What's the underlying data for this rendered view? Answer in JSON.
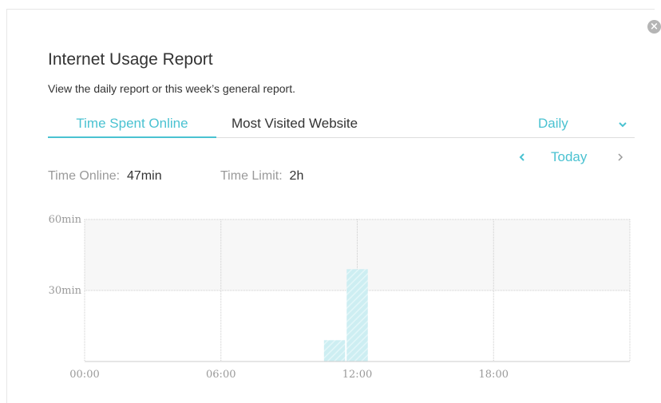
{
  "dialog": {
    "title": "Internet Usage Report",
    "subtitle": "View the daily report or this week’s general report.",
    "close_icon": "close-icon"
  },
  "tabs": [
    {
      "label": "Time Spent Online",
      "active": true
    },
    {
      "label": "Most Visited Website",
      "active": false
    }
  ],
  "period": {
    "selected": "Daily",
    "icon": "chevron-down-icon"
  },
  "date_nav": {
    "prev_icon": "chevron-left-icon",
    "label": "Today",
    "next_icon": "chevron-right-icon"
  },
  "stats": {
    "online_label": "Time Online:",
    "online_value": "47min",
    "limit_label": "Time Limit:",
    "limit_value": "2h"
  },
  "colors": {
    "accent": "#4ac2d1",
    "bar": "#cdeef2",
    "bar_stripe": "#e3f6f8",
    "limit_band": "#f7f7f7",
    "grid": "#cccccc"
  },
  "chart_data": {
    "type": "bar",
    "x_unit": "hour",
    "xlim": [
      0,
      24
    ],
    "x_ticks": [
      "00:00",
      "06:00",
      "12:00",
      "18:00"
    ],
    "y_ticks": [
      "60min",
      "30min"
    ],
    "ylim": [
      0,
      60
    ],
    "bars": [
      {
        "hour": 11,
        "minutes": 9
      },
      {
        "hour": 12,
        "minutes": 39
      }
    ],
    "shaded_band": [
      30,
      60
    ],
    "grid": true,
    "legend": "none"
  }
}
